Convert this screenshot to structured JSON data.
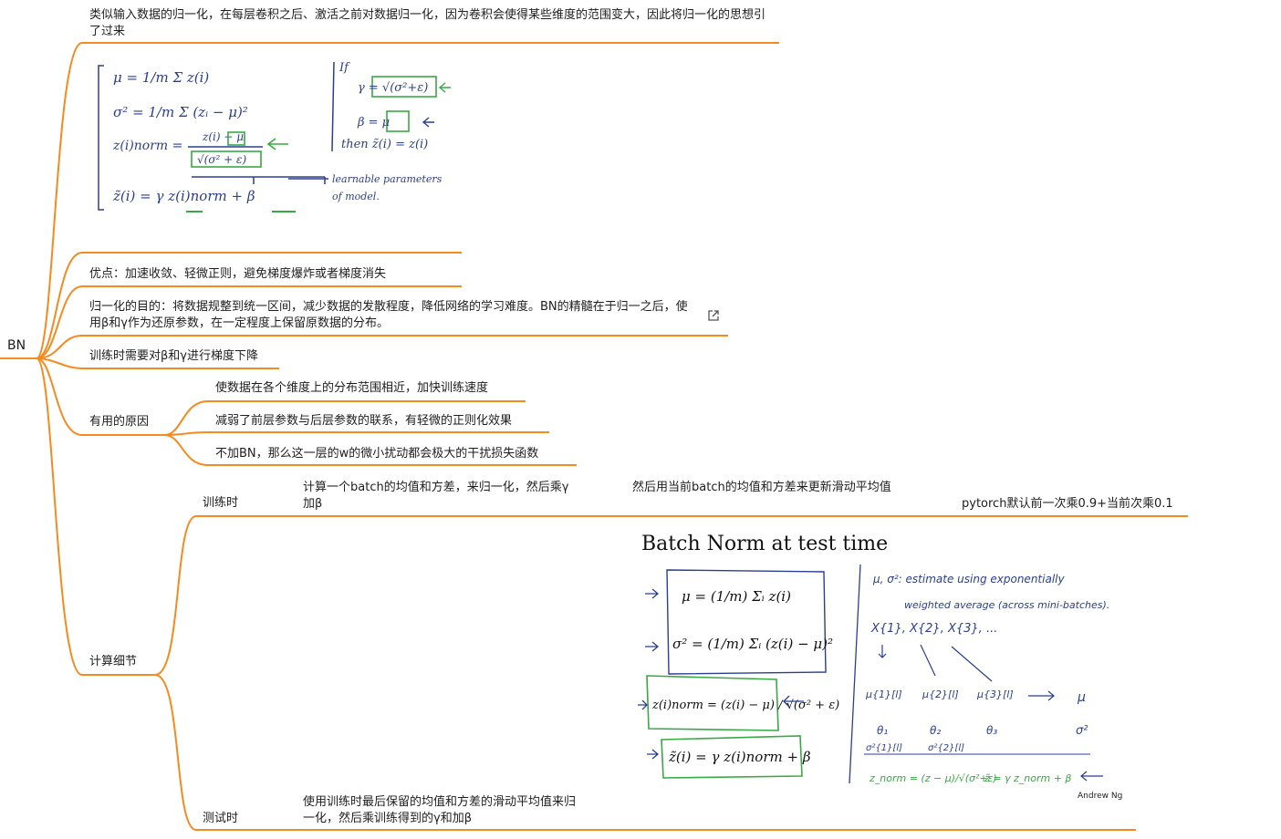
{
  "root": {
    "label": "BN"
  },
  "nodes": {
    "intro": "类似输入数据的归一化，在每层卷积之后、激活之前对数据归一化，因为卷积会使得某些维度的范围变大，因此将归一化的思想引了过来",
    "advantages": "优点：加速收敛、轻微正则，避免梯度爆炸或者梯度消失",
    "purpose": "归一化的目的：将数据规整到统一区间，减少数据的发散程度，降低网络的学习难度。BN的精髓在于归一之后，使用β和γ作为还原参数，在一定程度上保留原数据的分布。",
    "training_grad": "训练时需要对β和γ进行梯度下降",
    "useful_reasons": {
      "label": "有用的原因",
      "children": [
        "使数据在各个维度上的分布范围相近，加快训练速度",
        "减弱了前层参数与后层参数的联系，有轻微的正则化效果",
        "不加BN，那么这一层的w的微小扰动都会极大的干扰损失函数"
      ]
    },
    "calc_details": {
      "label": "计算细节",
      "training": {
        "label": "训练时",
        "step1": "计算一个batch的均值和方差，来归一化，然后乘γ加β",
        "step2": "然后用当前batch的均值和方差来更新滑动平均值",
        "step3": "pytorch默认前一次乘0.9+当前次乘0.1"
      },
      "testing": {
        "label": "测试时",
        "text": "使用训练时最后保留的均值和方差的滑动平均值来归一化，然后乘训练得到的γ和加β"
      }
    }
  },
  "image1": {
    "lines": [
      "μ = 1/m Σ z(i)",
      "σ² = 1/m Σ (zᵢ − μ)²",
      "z(i)norm =",
      "z(i) − μ",
      "√(σ² + ε)",
      "z̃(i) = γ z(i)norm + β"
    ],
    "right": [
      "If",
      "γ = √(σ²+ε)",
      "β = μ",
      "then z̃(i) = z(i)",
      "learnable parameters",
      "of model."
    ]
  },
  "image2": {
    "title": "Batch Norm at test time",
    "formulas": [
      "μ = (1/m) Σᵢ z(i)",
      "σ² = (1/m) Σᵢ (z(i) − μ)²",
      "z(i)norm = (z(i) − μ) / √(σ² + ε)",
      "z̃(i) = γ z(i)norm + β"
    ],
    "notes": [
      "μ, σ²: estimate using exponentially",
      "weighted average (across mini-batches).",
      "X{1}, X{2}, X{3}, ...",
      "μ{1}[l]",
      "μ{2}[l]",
      "μ{3}[l]",
      "μ",
      "θ₁",
      "θ₂",
      "θ₃",
      "σ²",
      "σ²{1}[l]",
      "σ²{2}[l]",
      "z_norm = (z − μ)/√(σ²+ε)",
      "z̃ = γ z_norm + β"
    ],
    "credit": "Andrew Ng"
  },
  "colors": {
    "branch": "#f58a1f",
    "ink": "#2b3f8f",
    "green": "#3aa844"
  }
}
